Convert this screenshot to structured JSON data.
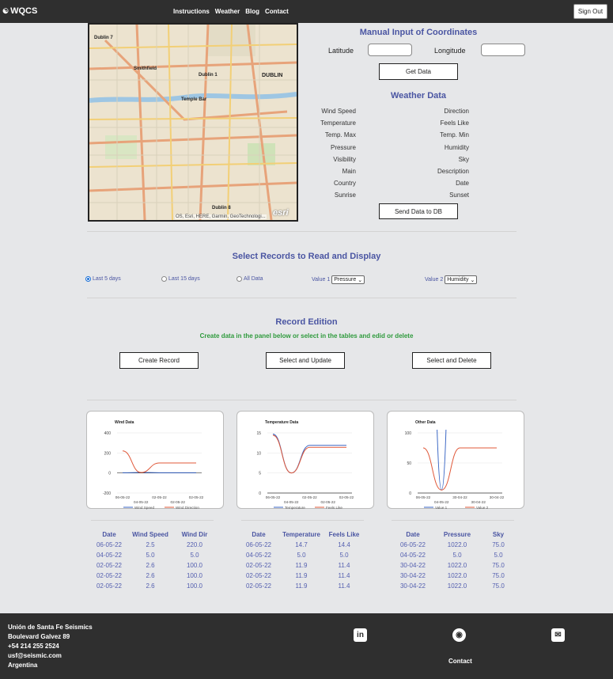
{
  "nav": {
    "brand": "WQCS",
    "logo_icon": "wind-logo-icon",
    "links": [
      "Instructions",
      "Weather",
      "Blog",
      "Contact"
    ],
    "sign_out": "Sign Out"
  },
  "map": {
    "labels": [
      "Dublin 7",
      "Smithfield",
      "Dublin 1",
      "DUBLIN",
      "Temple Bar",
      "Dublin 8"
    ],
    "attribution": "OS, Esri, HERE, Garmin, GeoTechnologi...",
    "logo_text": "esri"
  },
  "coordinates": {
    "title": "Manual Input of Coordinates",
    "latitude_label": "Latitude",
    "latitude_value": "",
    "longitude_label": "Longitude",
    "longitude_value": "",
    "get_data": "Get Data"
  },
  "weather": {
    "title": "Weather Data",
    "left": [
      "Wind Speed",
      "Temperature",
      "Temp. Max",
      "Pressure",
      "Visibility",
      "Main",
      "Country",
      "Sunrise"
    ],
    "right": [
      "Direction",
      "Feels Like",
      "Temp. Min",
      "Humidity",
      "Sky",
      "Description",
      "Date",
      "Sunset"
    ],
    "send": "Send Data to DB"
  },
  "records": {
    "title": "Select Records to Read and Display",
    "options": [
      {
        "label": "Last 5 days",
        "checked": true
      },
      {
        "label": "Last 15 days",
        "checked": false
      },
      {
        "label": "All Data",
        "checked": false
      }
    ],
    "value1_label": "Value 1",
    "value1_selected": "Pressure",
    "value2_label": "Value 2",
    "value2_selected": "Humidity"
  },
  "edition": {
    "title": "Record Edition",
    "subtitle": "Create data in the panel below or select in the tables and edid or delete",
    "buttons": [
      "Create Record",
      "Select and Update",
      "Select and Delete"
    ]
  },
  "chart_data": [
    {
      "type": "line",
      "title": "Wind Data",
      "x": [
        "06-05-22",
        "04-05-22",
        "02-05-22",
        "02-05-22",
        "02-05-22"
      ],
      "x_ticks_top": [
        "06-05-22",
        "02-05-22",
        "02-05-22"
      ],
      "x_ticks_bottom": [
        "04-05-22",
        "02-05-22"
      ],
      "series": [
        {
          "name": "Wind Speed",
          "values": [
            2.5,
            5.0,
            2.6,
            2.6,
            2.6
          ],
          "color": "#3a66c4"
        },
        {
          "name": "Wind Direction",
          "values": [
            220.0,
            5.0,
            100.0,
            100.0,
            100.0
          ],
          "color": "#e0593a"
        }
      ],
      "ylim": [
        -200,
        400
      ],
      "yticks": [
        "400",
        "200",
        "0",
        "-200"
      ],
      "grid": true,
      "legend": "bottom"
    },
    {
      "type": "line",
      "title": "Temperature Data",
      "x": [
        "06-05-22",
        "04-05-22",
        "02-05-22",
        "02-05-22",
        "02-05-22"
      ],
      "x_ticks_top": [
        "06-05-22",
        "02-05-22",
        "02-05-22"
      ],
      "x_ticks_bottom": [
        "04-05-22",
        "02-05-22"
      ],
      "series": [
        {
          "name": "Temperature",
          "values": [
            14.7,
            5.0,
            11.9,
            11.9,
            11.9
          ],
          "color": "#3a66c4"
        },
        {
          "name": "Feels Like",
          "values": [
            14.4,
            5.0,
            11.4,
            11.4,
            11.4
          ],
          "color": "#e0593a"
        }
      ],
      "ylim": [
        0,
        15
      ],
      "yticks": [
        "15",
        "10",
        "5",
        "0"
      ],
      "grid": true,
      "legend": "bottom"
    },
    {
      "type": "line",
      "title": "Other Data",
      "x": [
        "06-05-22",
        "04-05-22",
        "30-04-22",
        "30-04-22",
        "30-04-22"
      ],
      "x_ticks_top": [
        "06-05-22",
        "30-04-22",
        "30-04-22"
      ],
      "x_ticks_bottom": [
        "04-05-22",
        "30-04-22"
      ],
      "series": [
        {
          "name": "Value 1",
          "values": [
            1022.0,
            5.0,
            1022.0,
            1022.0,
            1022.0
          ],
          "color": "#3a66c4"
        },
        {
          "name": "Value 2",
          "values": [
            75.0,
            5.0,
            75.0,
            75.0,
            75.0
          ],
          "color": "#e0593a"
        }
      ],
      "ylim": [
        0,
        100
      ],
      "yticks": [
        "100",
        "50",
        "0"
      ],
      "grid": true,
      "legend": "bottom"
    }
  ],
  "tables": [
    {
      "headers": [
        "Date",
        "Wind Speed",
        "Wind Dir"
      ],
      "rows": [
        [
          "06-05-22",
          "2.5",
          "220.0"
        ],
        [
          "04-05-22",
          "5.0",
          "5.0"
        ],
        [
          "02-05-22",
          "2.6",
          "100.0"
        ],
        [
          "02-05-22",
          "2.6",
          "100.0"
        ],
        [
          "02-05-22",
          "2.6",
          "100.0"
        ]
      ]
    },
    {
      "headers": [
        "Date",
        "Temperature",
        "Feels Like"
      ],
      "rows": [
        [
          "06-05-22",
          "14.7",
          "14.4"
        ],
        [
          "04-05-22",
          "5.0",
          "5.0"
        ],
        [
          "02-05-22",
          "11.9",
          "11.4"
        ],
        [
          "02-05-22",
          "11.9",
          "11.4"
        ],
        [
          "02-05-22",
          "11.9",
          "11.4"
        ]
      ]
    },
    {
      "headers": [
        "Date",
        "Pressure",
        "Sky"
      ],
      "rows": [
        [
          "06-05-22",
          "1022.0",
          "75.0"
        ],
        [
          "04-05-22",
          "5.0",
          "5.0"
        ],
        [
          "30-04-22",
          "1022.0",
          "75.0"
        ],
        [
          "30-04-22",
          "1022.0",
          "75.0"
        ],
        [
          "30-04-22",
          "1022.0",
          "75.0"
        ]
      ]
    }
  ],
  "footer": {
    "lines": [
      "Unión de Santa Fe Seismics",
      "Boulevard Galvez 89",
      "+54 214 255 2524",
      "usf@seismic.com",
      "Argentina"
    ],
    "icons": [
      "linkedin-icon",
      "github-icon",
      "mail-icon"
    ],
    "contact": "Contact"
  }
}
